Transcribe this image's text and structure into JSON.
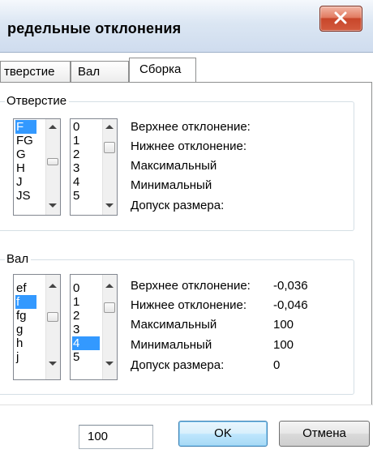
{
  "window": {
    "title": "редельные отклонения",
    "close_glyph": "X"
  },
  "tabs": [
    {
      "label": "тверстие"
    },
    {
      "label": "Вал"
    },
    {
      "label": "Сборка"
    }
  ],
  "hole_group": {
    "title": "Отверстие",
    "letters": [
      "F",
      "FG",
      "G",
      "H",
      "J",
      "JS"
    ],
    "selected_letter": "F",
    "grades": [
      "0",
      "1",
      "2",
      "3",
      "4",
      "5"
    ],
    "selected_grade": null,
    "labels": {
      "upper": "Верхнее отклонение:",
      "lower": "Нижнее отклонение:",
      "max": "Максимальный",
      "min": "Минимальный",
      "tolerance": "Допуск размера:"
    },
    "values": {
      "upper": "",
      "lower": "",
      "max": "",
      "min": "",
      "tolerance": ""
    }
  },
  "shaft_group": {
    "title": "Вал",
    "letters": [
      "ef",
      "f",
      "fg",
      "g",
      "h",
      "j"
    ],
    "selected_letter": "f",
    "grades": [
      "0",
      "1",
      "2",
      "3",
      "4",
      "5"
    ],
    "selected_grade": "4",
    "labels": {
      "upper": "Верхнее отклонение:",
      "lower": "Нижнее отклонение:",
      "max": "Максимальный",
      "min": "Минимальный",
      "tolerance": "Допуск размера:"
    },
    "values": {
      "upper": "-0,036",
      "lower": "-0,046",
      "max": "100",
      "min": "100",
      "tolerance": "0"
    }
  },
  "footer": {
    "size_value": "100",
    "ok_label": "OK",
    "cancel_label": "Отмена"
  },
  "colors": {
    "selection": "#3399ff",
    "titlebar": "#dbe6f3",
    "close_button": "#c8462a"
  }
}
